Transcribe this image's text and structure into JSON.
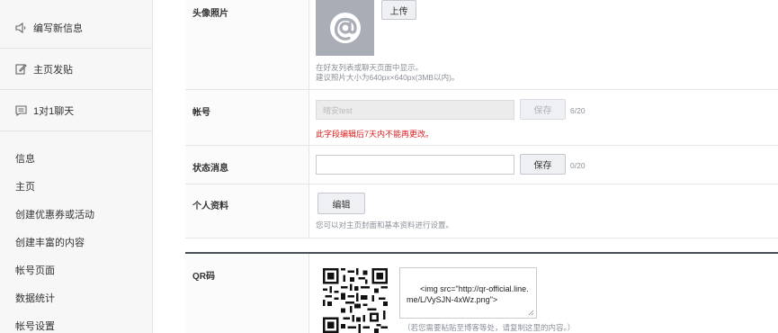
{
  "sidebar": {
    "top_items": [
      {
        "label": "编写新信息",
        "icon": "megaphone-icon"
      },
      {
        "label": "主页发贴",
        "icon": "edit-post-icon"
      },
      {
        "label": "1对1聊天",
        "icon": "chat-icon"
      }
    ],
    "links": [
      "信息",
      "主页",
      "创建优惠券或活动",
      "创建丰富的内容",
      "帐号页面",
      "数据统计",
      "帐号设置"
    ]
  },
  "profile": {
    "photo": {
      "label": "头像照片",
      "upload_label": "上传",
      "hint_line1": "在好友列表或聊天页面中显示。",
      "hint_line2": "建议照片大小为640px×640px(3MB以内)。"
    },
    "account": {
      "label": "帐号",
      "value": "晴安test",
      "save_label": "保存",
      "counter": "6/20",
      "error": "此字段编辑后7天内不能再更改。"
    },
    "status": {
      "label": "状态消息",
      "value": "",
      "save_label": "保存",
      "counter": "0/20"
    },
    "personal": {
      "label": "个人资料",
      "edit_label": "编辑",
      "hint": "您可以对主页封面和基本资料进行设置。"
    }
  },
  "qr": {
    "label": "QR码",
    "code_text": "<img src=\"http://qr-official.line.me/L/VySJN-4xWz.png\">",
    "hint": "（若您需要粘贴至博客等处，请复制这里的内容。）"
  }
}
